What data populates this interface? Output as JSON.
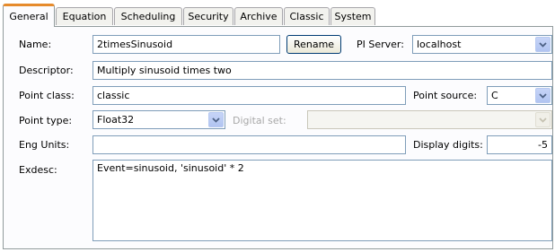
{
  "tabs": [
    {
      "label": "General",
      "active": true
    },
    {
      "label": "Equation"
    },
    {
      "label": "Scheduling"
    },
    {
      "label": "Security"
    },
    {
      "label": "Archive"
    },
    {
      "label": "Classic"
    },
    {
      "label": "System"
    }
  ],
  "form": {
    "name_label": "Name:",
    "name_value": "2timesSinusoid",
    "rename_button": "Rename",
    "pi_server_label": "PI Server:",
    "pi_server_value": "localhost",
    "descriptor_label": "Descriptor:",
    "descriptor_value": "Multiply sinusoid times two",
    "point_class_label": "Point class:",
    "point_class_value": "classic",
    "point_source_label": "Point source:",
    "point_source_value": "C",
    "point_type_label": "Point type:",
    "point_type_value": "Float32",
    "digital_set_label": "Digital set:",
    "digital_set_value": "",
    "eng_units_label": "Eng Units:",
    "eng_units_value": "",
    "display_digits_label": "Display digits:",
    "display_digits_value": "-5",
    "exdesc_label": "Exdesc:",
    "exdesc_value": "Event=sinusoid, 'sinusoid' * 2"
  },
  "colors": {
    "active_tab_accent": "#e68b2c",
    "field_border": "#7f9db9",
    "button_border": "#003c74"
  },
  "icons": {
    "dropdown": "chevron-down-icon"
  }
}
